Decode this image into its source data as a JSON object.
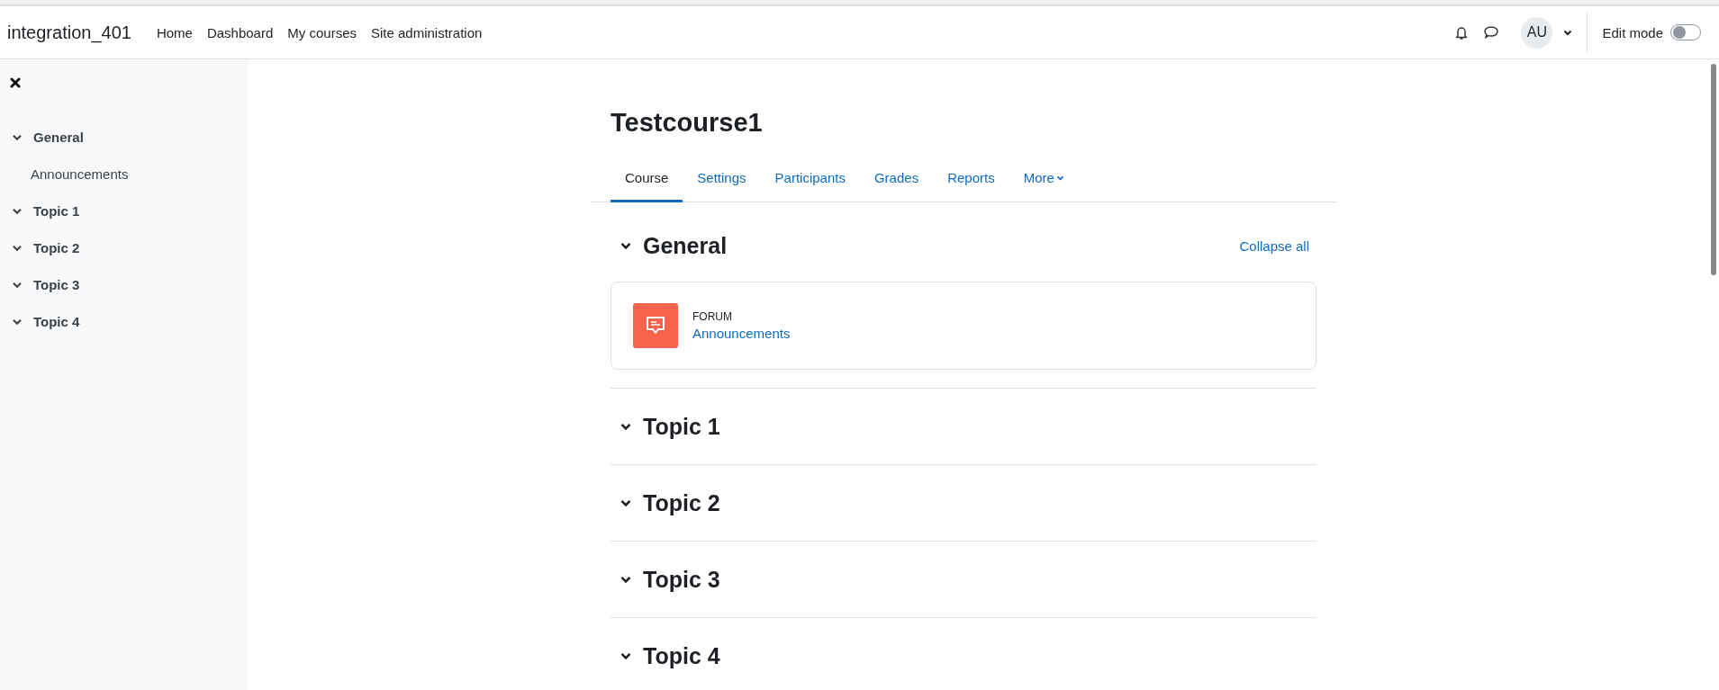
{
  "site_name": "integration_401",
  "nav": [
    {
      "label": "Home"
    },
    {
      "label": "Dashboard"
    },
    {
      "label": "My courses"
    },
    {
      "label": "Site administration"
    }
  ],
  "user": {
    "initials": "AU"
  },
  "edit_mode": {
    "label": "Edit mode",
    "on": false
  },
  "sidebar": {
    "items": [
      {
        "label": "General",
        "expanded": true,
        "children": [
          {
            "label": "Announcements"
          }
        ]
      },
      {
        "label": "Topic 1",
        "expanded": true
      },
      {
        "label": "Topic 2",
        "expanded": true
      },
      {
        "label": "Topic 3",
        "expanded": true
      },
      {
        "label": "Topic 4",
        "expanded": true
      }
    ]
  },
  "course": {
    "title": "Testcourse1",
    "tabs": [
      {
        "label": "Course",
        "selected": true,
        "kind": "link"
      },
      {
        "label": "Settings",
        "selected": false,
        "kind": "link"
      },
      {
        "label": "Participants",
        "selected": false,
        "kind": "link"
      },
      {
        "label": "Grades",
        "selected": false,
        "kind": "link"
      },
      {
        "label": "Reports",
        "selected": false,
        "kind": "link"
      },
      {
        "label": "More",
        "selected": false,
        "kind": "menu"
      }
    ],
    "collapse_all": "Collapse all",
    "sections": [
      {
        "title": "General",
        "expanded": true,
        "activities": [
          {
            "type": "FORUM",
            "name": "Announcements"
          }
        ]
      },
      {
        "title": "Topic 1",
        "expanded": true
      },
      {
        "title": "Topic 2",
        "expanded": true
      },
      {
        "title": "Topic 3",
        "expanded": true
      },
      {
        "title": "Topic 4",
        "expanded": true
      }
    ]
  }
}
